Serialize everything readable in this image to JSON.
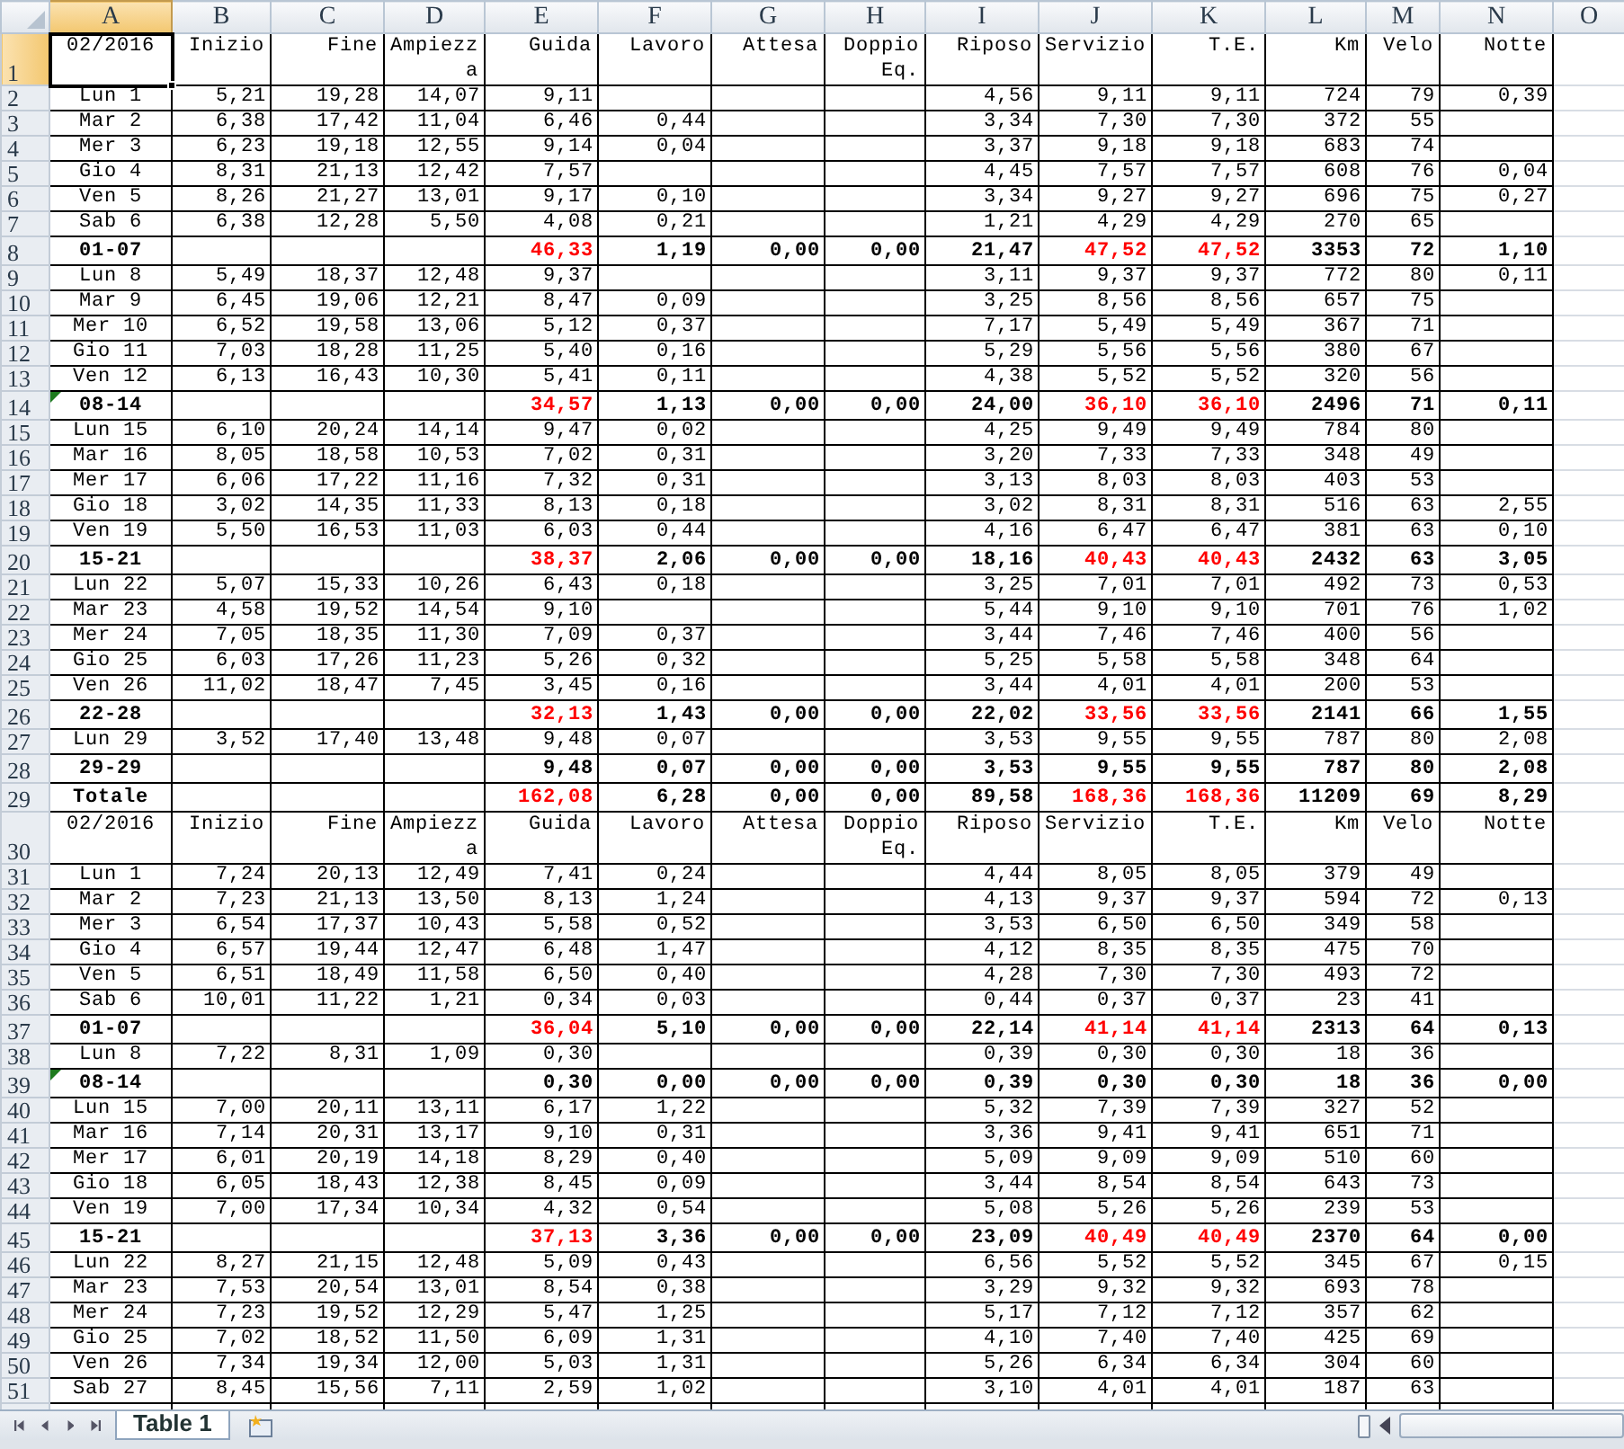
{
  "columns": [
    {
      "label": "A",
      "selected": true
    },
    {
      "label": "B",
      "selected": false
    },
    {
      "label": "C",
      "selected": false
    },
    {
      "label": "D",
      "selected": false
    },
    {
      "label": "E",
      "selected": false
    },
    {
      "label": "F",
      "selected": false
    },
    {
      "label": "G",
      "selected": false
    },
    {
      "label": "H",
      "selected": false
    },
    {
      "label": "I",
      "selected": false
    },
    {
      "label": "J",
      "selected": false
    },
    {
      "label": "K",
      "selected": false
    },
    {
      "label": "L",
      "selected": false
    },
    {
      "label": "M",
      "selected": false
    },
    {
      "label": "N",
      "selected": false
    },
    {
      "label": "O",
      "selected": false
    }
  ],
  "rows": [
    {
      "num": "1",
      "kind": "header",
      "selected": true,
      "warning": false,
      "cells": [
        "02/2016",
        "Inizio",
        "Fine",
        "Ampiezza",
        "Guida",
        "Lavoro",
        "Attesa",
        "Doppio Eq.",
        "Riposo",
        "Servizio",
        "T.E.",
        "Km",
        "Velo",
        "Notte"
      ]
    },
    {
      "num": "2",
      "kind": "day",
      "selected": false,
      "warning": false,
      "cells": [
        "Lun 1",
        "5,21",
        "19,28",
        "14,07",
        "9,11",
        null,
        null,
        null,
        "4,56",
        "9,11",
        "9,11",
        "724",
        "79",
        "0,39"
      ]
    },
    {
      "num": "3",
      "kind": "day",
      "selected": false,
      "warning": false,
      "cells": [
        "Mar 2",
        "6,38",
        "17,42",
        "11,04",
        "6,46",
        "0,44",
        null,
        null,
        "3,34",
        "7,30",
        "7,30",
        "372",
        "55"
      ]
    },
    {
      "num": "4",
      "kind": "day",
      "selected": false,
      "warning": false,
      "cells": [
        "Mer 3",
        "6,23",
        "19,18",
        "12,55",
        "9,14",
        "0,04",
        null,
        null,
        "3,37",
        "9,18",
        "9,18",
        "683",
        "74"
      ]
    },
    {
      "num": "5",
      "kind": "day",
      "selected": false,
      "warning": false,
      "cells": [
        "Gio 4",
        "8,31",
        "21,13",
        "12,42",
        "7,57",
        null,
        null,
        null,
        "4,45",
        "7,57",
        "7,57",
        "608",
        "76",
        "0,04"
      ]
    },
    {
      "num": "6",
      "kind": "day",
      "selected": false,
      "warning": false,
      "cells": [
        "Ven 5",
        "8,26",
        "21,27",
        "13,01",
        "9,17",
        "0,10",
        null,
        null,
        "3,34",
        "9,27",
        "9,27",
        "696",
        "75",
        "0,27"
      ]
    },
    {
      "num": "7",
      "kind": "day",
      "selected": false,
      "warning": false,
      "cells": [
        "Sab 6",
        "6,38",
        "12,28",
        "5,50",
        "4,08",
        "0,21",
        null,
        null,
        "1,21",
        "4,29",
        "4,29",
        "270",
        "65"
      ]
    },
    {
      "num": "8",
      "kind": "subtotal",
      "selected": false,
      "warning": false,
      "cells": [
        "01-07",
        null,
        null,
        null,
        {
          "text": "46,33",
          "color": "#ff0000"
        },
        "1,19",
        "0,00",
        "0,00",
        "21,47",
        {
          "text": "47,52",
          "color": "#ff0000"
        },
        {
          "text": "47,52",
          "color": "#ff0000"
        },
        "3353",
        "72",
        "1,10"
      ]
    },
    {
      "num": "9",
      "kind": "day",
      "selected": false,
      "warning": false,
      "cells": [
        "Lun 8",
        "5,49",
        "18,37",
        "12,48",
        "9,37",
        null,
        null,
        null,
        "3,11",
        "9,37",
        "9,37",
        "772",
        "80",
        "0,11"
      ]
    },
    {
      "num": "10",
      "kind": "day",
      "selected": false,
      "warning": false,
      "cells": [
        "Mar 9",
        "6,45",
        "19,06",
        "12,21",
        "8,47",
        "0,09",
        null,
        null,
        "3,25",
        "8,56",
        "8,56",
        "657",
        "75"
      ]
    },
    {
      "num": "11",
      "kind": "day",
      "selected": false,
      "warning": false,
      "cells": [
        "Mer 10",
        "6,52",
        "19,58",
        "13,06",
        "5,12",
        "0,37",
        null,
        null,
        "7,17",
        "5,49",
        "5,49",
        "367",
        "71"
      ]
    },
    {
      "num": "12",
      "kind": "day",
      "selected": false,
      "warning": false,
      "cells": [
        "Gio 11",
        "7,03",
        "18,28",
        "11,25",
        "5,40",
        "0,16",
        null,
        null,
        "5,29",
        "5,56",
        "5,56",
        "380",
        "67"
      ]
    },
    {
      "num": "13",
      "kind": "day",
      "selected": false,
      "warning": false,
      "cells": [
        "Ven 12",
        "6,13",
        "16,43",
        "10,30",
        "5,41",
        "0,11",
        null,
        null,
        "4,38",
        "5,52",
        "5,52",
        "320",
        "56"
      ]
    },
    {
      "num": "14",
      "kind": "subtotal",
      "selected": false,
      "warning": true,
      "cells": [
        "08-14",
        null,
        null,
        null,
        {
          "text": "34,57",
          "color": "#ff0000"
        },
        "1,13",
        "0,00",
        "0,00",
        "24,00",
        {
          "text": "36,10",
          "color": "#ff0000"
        },
        {
          "text": "36,10",
          "color": "#ff0000"
        },
        "2496",
        "71",
        "0,11"
      ]
    },
    {
      "num": "15",
      "kind": "day",
      "selected": false,
      "warning": false,
      "cells": [
        "Lun 15",
        "6,10",
        "20,24",
        "14,14",
        "9,47",
        "0,02",
        null,
        null,
        "4,25",
        "9,49",
        "9,49",
        "784",
        "80"
      ]
    },
    {
      "num": "16",
      "kind": "day",
      "selected": false,
      "warning": false,
      "cells": [
        "Mar 16",
        "8,05",
        "18,58",
        "10,53",
        "7,02",
        "0,31",
        null,
        null,
        "3,20",
        "7,33",
        "7,33",
        "348",
        "49"
      ]
    },
    {
      "num": "17",
      "kind": "day",
      "selected": false,
      "warning": false,
      "cells": [
        "Mer 17",
        "6,06",
        "17,22",
        "11,16",
        "7,32",
        "0,31",
        null,
        null,
        "3,13",
        "8,03",
        "8,03",
        "403",
        "53"
      ]
    },
    {
      "num": "18",
      "kind": "day",
      "selected": false,
      "warning": false,
      "cells": [
        "Gio 18",
        "3,02",
        "14,35",
        "11,33",
        "8,13",
        "0,18",
        null,
        null,
        "3,02",
        "8,31",
        "8,31",
        "516",
        "63",
        "2,55"
      ]
    },
    {
      "num": "19",
      "kind": "day",
      "selected": false,
      "warning": false,
      "cells": [
        "Ven 19",
        "5,50",
        "16,53",
        "11,03",
        "6,03",
        "0,44",
        null,
        null,
        "4,16",
        "6,47",
        "6,47",
        "381",
        "63",
        "0,10"
      ]
    },
    {
      "num": "20",
      "kind": "subtotal",
      "selected": false,
      "warning": false,
      "cells": [
        "15-21",
        null,
        null,
        null,
        {
          "text": "38,37",
          "color": "#ff0000"
        },
        "2,06",
        "0,00",
        "0,00",
        "18,16",
        {
          "text": "40,43",
          "color": "#ff0000"
        },
        {
          "text": "40,43",
          "color": "#ff0000"
        },
        "2432",
        "63",
        "3,05"
      ]
    },
    {
      "num": "21",
      "kind": "day",
      "selected": false,
      "warning": false,
      "cells": [
        "Lun 22",
        "5,07",
        "15,33",
        "10,26",
        "6,43",
        "0,18",
        null,
        null,
        "3,25",
        "7,01",
        "7,01",
        "492",
        "73",
        "0,53"
      ]
    },
    {
      "num": "22",
      "kind": "day",
      "selected": false,
      "warning": false,
      "cells": [
        "Mar 23",
        "4,58",
        "19,52",
        "14,54",
        "9,10",
        null,
        null,
        null,
        "5,44",
        "9,10",
        "9,10",
        "701",
        "76",
        "1,02"
      ]
    },
    {
      "num": "23",
      "kind": "day",
      "selected": false,
      "warning": false,
      "cells": [
        "Mer 24",
        "7,05",
        "18,35",
        "11,30",
        "7,09",
        "0,37",
        null,
        null,
        "3,44",
        "7,46",
        "7,46",
        "400",
        "56"
      ]
    },
    {
      "num": "24",
      "kind": "day",
      "selected": false,
      "warning": false,
      "cells": [
        "Gio 25",
        "6,03",
        "17,26",
        "11,23",
        "5,26",
        "0,32",
        null,
        null,
        "5,25",
        "5,58",
        "5,58",
        "348",
        "64"
      ]
    },
    {
      "num": "25",
      "kind": "day",
      "selected": false,
      "warning": false,
      "cells": [
        "Ven 26",
        "11,02",
        "18,47",
        "7,45",
        "3,45",
        "0,16",
        null,
        null,
        "3,44",
        "4,01",
        "4,01",
        "200",
        "53"
      ]
    },
    {
      "num": "26",
      "kind": "subtotal",
      "selected": false,
      "warning": false,
      "cells": [
        "22-28",
        null,
        null,
        null,
        {
          "text": "32,13",
          "color": "#ff0000"
        },
        "1,43",
        "0,00",
        "0,00",
        "22,02",
        {
          "text": "33,56",
          "color": "#ff0000"
        },
        {
          "text": "33,56",
          "color": "#ff0000"
        },
        "2141",
        "66",
        "1,55"
      ]
    },
    {
      "num": "27",
      "kind": "day",
      "selected": false,
      "warning": false,
      "cells": [
        "Lun 29",
        "3,52",
        "17,40",
        "13,48",
        "9,48",
        "0,07",
        null,
        null,
        "3,53",
        "9,55",
        "9,55",
        "787",
        "80",
        "2,08"
      ]
    },
    {
      "num": "28",
      "kind": "subtotal",
      "selected": false,
      "warning": false,
      "cells": [
        "29-29",
        null,
        null,
        null,
        "9,48",
        "0,07",
        "0,00",
        "0,00",
        "3,53",
        "9,55",
        "9,55",
        "787",
        "80",
        "2,08"
      ]
    },
    {
      "num": "29",
      "kind": "subtotal",
      "selected": false,
      "warning": false,
      "cells": [
        "Totale",
        null,
        null,
        null,
        {
          "text": "162,08",
          "color": "#ff0000"
        },
        "6,28",
        "0,00",
        "0,00",
        "89,58",
        {
          "text": "168,36",
          "color": "#ff0000"
        },
        {
          "text": "168,36",
          "color": "#ff0000"
        },
        "11209",
        "69",
        "8,29"
      ]
    },
    {
      "num": "30",
      "kind": "header",
      "selected": false,
      "warning": false,
      "cells": [
        "02/2016",
        "Inizio",
        "Fine",
        "Ampiezza",
        "Guida",
        "Lavoro",
        "Attesa",
        "Doppio Eq.",
        "Riposo",
        "Servizio",
        "T.E.",
        "Km",
        "Velo",
        "Notte"
      ]
    },
    {
      "num": "31",
      "kind": "day",
      "selected": false,
      "warning": false,
      "cells": [
        "Lun 1",
        "7,24",
        "20,13",
        "12,49",
        "7,41",
        "0,24",
        null,
        null,
        "4,44",
        "8,05",
        "8,05",
        "379",
        "49"
      ]
    },
    {
      "num": "32",
      "kind": "day",
      "selected": false,
      "warning": false,
      "cells": [
        "Mar 2",
        "7,23",
        "21,13",
        "13,50",
        "8,13",
        "1,24",
        null,
        null,
        "4,13",
        "9,37",
        "9,37",
        "594",
        "72",
        "0,13"
      ]
    },
    {
      "num": "33",
      "kind": "day",
      "selected": false,
      "warning": false,
      "cells": [
        "Mer 3",
        "6,54",
        "17,37",
        "10,43",
        "5,58",
        "0,52",
        null,
        null,
        "3,53",
        "6,50",
        "6,50",
        "349",
        "58"
      ]
    },
    {
      "num": "34",
      "kind": "day",
      "selected": false,
      "warning": false,
      "cells": [
        "Gio 4",
        "6,57",
        "19,44",
        "12,47",
        "6,48",
        "1,47",
        null,
        null,
        "4,12",
        "8,35",
        "8,35",
        "475",
        "70"
      ]
    },
    {
      "num": "35",
      "kind": "day",
      "selected": false,
      "warning": false,
      "cells": [
        "Ven 5",
        "6,51",
        "18,49",
        "11,58",
        "6,50",
        "0,40",
        null,
        null,
        "4,28",
        "7,30",
        "7,30",
        "493",
        "72"
      ]
    },
    {
      "num": "36",
      "kind": "day",
      "selected": false,
      "warning": false,
      "cells": [
        "Sab 6",
        "10,01",
        "11,22",
        "1,21",
        "0,34",
        "0,03",
        null,
        null,
        "0,44",
        "0,37",
        "0,37",
        "23",
        "41"
      ]
    },
    {
      "num": "37",
      "kind": "subtotal",
      "selected": false,
      "warning": false,
      "cells": [
        "01-07",
        null,
        null,
        null,
        {
          "text": "36,04",
          "color": "#ff0000"
        },
        "5,10",
        "0,00",
        "0,00",
        "22,14",
        {
          "text": "41,14",
          "color": "#ff0000"
        },
        {
          "text": "41,14",
          "color": "#ff0000"
        },
        "2313",
        "64",
        "0,13"
      ]
    },
    {
      "num": "38",
      "kind": "day",
      "selected": false,
      "warning": false,
      "cells": [
        "Lun 8",
        "7,22",
        "8,31",
        "1,09",
        "0,30",
        null,
        null,
        null,
        "0,39",
        "0,30",
        "0,30",
        "18",
        "36"
      ]
    },
    {
      "num": "39",
      "kind": "subtotal",
      "selected": false,
      "warning": true,
      "cells": [
        "08-14",
        null,
        null,
        null,
        "0,30",
        "0,00",
        "0,00",
        "0,00",
        "0,39",
        "0,30",
        "0,30",
        "18",
        "36",
        "0,00"
      ]
    },
    {
      "num": "40",
      "kind": "day",
      "selected": false,
      "warning": false,
      "cells": [
        "Lun 15",
        "7,00",
        "20,11",
        "13,11",
        "6,17",
        "1,22",
        null,
        null,
        "5,32",
        "7,39",
        "7,39",
        "327",
        "52"
      ]
    },
    {
      "num": "41",
      "kind": "day",
      "selected": false,
      "warning": false,
      "cells": [
        "Mar 16",
        "7,14",
        "20,31",
        "13,17",
        "9,10",
        "0,31",
        null,
        null,
        "3,36",
        "9,41",
        "9,41",
        "651",
        "71"
      ]
    },
    {
      "num": "42",
      "kind": "day",
      "selected": false,
      "warning": false,
      "cells": [
        "Mer 17",
        "6,01",
        "20,19",
        "14,18",
        "8,29",
        "0,40",
        null,
        null,
        "5,09",
        "9,09",
        "9,09",
        "510",
        "60"
      ]
    },
    {
      "num": "43",
      "kind": "day",
      "selected": false,
      "warning": false,
      "cells": [
        "Gio 18",
        "6,05",
        "18,43",
        "12,38",
        "8,45",
        "0,09",
        null,
        null,
        "3,44",
        "8,54",
        "8,54",
        "643",
        "73"
      ]
    },
    {
      "num": "44",
      "kind": "day",
      "selected": false,
      "warning": false,
      "cells": [
        "Ven 19",
        "7,00",
        "17,34",
        "10,34",
        "4,32",
        "0,54",
        null,
        null,
        "5,08",
        "5,26",
        "5,26",
        "239",
        "53"
      ]
    },
    {
      "num": "45",
      "kind": "subtotal",
      "selected": false,
      "warning": false,
      "cells": [
        "15-21",
        null,
        null,
        null,
        {
          "text": "37,13",
          "color": "#ff0000"
        },
        "3,36",
        "0,00",
        "0,00",
        "23,09",
        {
          "text": "40,49",
          "color": "#ff0000"
        },
        {
          "text": "40,49",
          "color": "#ff0000"
        },
        "2370",
        "64",
        "0,00"
      ]
    },
    {
      "num": "46",
      "kind": "day",
      "selected": false,
      "warning": false,
      "cells": [
        "Lun 22",
        "8,27",
        "21,15",
        "12,48",
        "5,09",
        "0,43",
        null,
        null,
        "6,56",
        "5,52",
        "5,52",
        "345",
        "67",
        "0,15"
      ]
    },
    {
      "num": "47",
      "kind": "day",
      "selected": false,
      "warning": false,
      "cells": [
        "Mar 23",
        "7,53",
        "20,54",
        "13,01",
        "8,54",
        "0,38",
        null,
        null,
        "3,29",
        "9,32",
        "9,32",
        "693",
        "78"
      ]
    },
    {
      "num": "48",
      "kind": "day",
      "selected": false,
      "warning": false,
      "cells": [
        "Mer 24",
        "7,23",
        "19,52",
        "12,29",
        "5,47",
        "1,25",
        null,
        null,
        "5,17",
        "7,12",
        "7,12",
        "357",
        "62"
      ]
    },
    {
      "num": "49",
      "kind": "day",
      "selected": false,
      "warning": false,
      "cells": [
        "Gio 25",
        "7,02",
        "18,52",
        "11,50",
        "6,09",
        "1,31",
        null,
        null,
        "4,10",
        "7,40",
        "7,40",
        "425",
        "69"
      ]
    },
    {
      "num": "50",
      "kind": "day",
      "selected": false,
      "warning": false,
      "cells": [
        "Ven 26",
        "7,34",
        "19,34",
        "12,00",
        "5,03",
        "1,31",
        null,
        null,
        "5,26",
        "6,34",
        "6,34",
        "304",
        "60"
      ]
    },
    {
      "num": "51",
      "kind": "day",
      "selected": false,
      "warning": false,
      "cells": [
        "Sab 27",
        "8,45",
        "15,56",
        "7,11",
        "2,59",
        "1,02",
        null,
        null,
        "3,10",
        "4,01",
        "4,01",
        "187",
        "63"
      ]
    }
  ],
  "sheet_tabs": [
    {
      "label": "Table 1",
      "selected": true
    }
  ]
}
